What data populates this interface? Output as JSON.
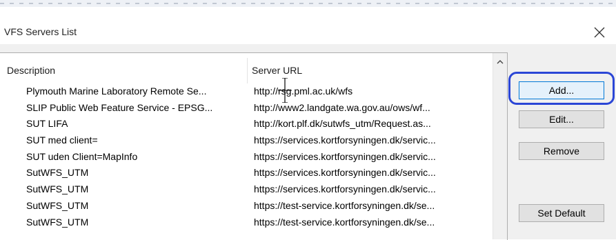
{
  "window": {
    "title": "VFS Servers List",
    "close_icon": "close-icon"
  },
  "table": {
    "columns": [
      "Description",
      "Server URL"
    ],
    "rows": [
      {
        "description": "Plymouth Marine Laboratory Remote Se...",
        "url": "http://rsg.pml.ac.uk/wfs"
      },
      {
        "description": "SLIP Public Web Feature Service - EPSG...",
        "url": "http://www2.landgate.wa.gov.au/ows/wf..."
      },
      {
        "description": "SUT LIFA",
        "url": "http://kort.plf.dk/sutwfs_utm/Request.as..."
      },
      {
        "description": "SUT med client=",
        "url": "https://services.kortforsyningen.dk/servic..."
      },
      {
        "description": "SUT uden Client=MapInfo",
        "url": "https://services.kortforsyningen.dk/servic..."
      },
      {
        "description": "SutWFS_UTM",
        "url": "https://services.kortforsyningen.dk/servic..."
      },
      {
        "description": "SutWFS_UTM",
        "url": "https://services.kortforsyningen.dk/servic..."
      },
      {
        "description": "SutWFS_UTM",
        "url": "https://test-service.kortforsyningen.dk/se..."
      },
      {
        "description": "SutWFS_UTM",
        "url": "https://test-service.kortforsyningen.dk/se..."
      }
    ]
  },
  "buttons": {
    "add": "Add...",
    "edit": "Edit...",
    "remove": "Remove",
    "set_default": "Set Default"
  },
  "colors": {
    "highlight": "#2b46d6",
    "dialog_bg": "#f0f0f0"
  }
}
